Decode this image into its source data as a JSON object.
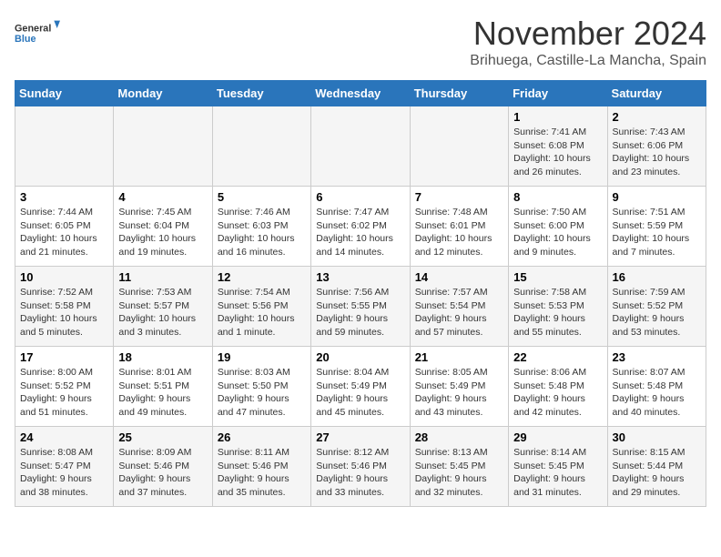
{
  "header": {
    "logo_line1": "General",
    "logo_line2": "Blue",
    "month": "November 2024",
    "location": "Brihuega, Castille-La Mancha, Spain"
  },
  "weekdays": [
    "Sunday",
    "Monday",
    "Tuesday",
    "Wednesday",
    "Thursday",
    "Friday",
    "Saturday"
  ],
  "weeks": [
    [
      {
        "day": "",
        "info": ""
      },
      {
        "day": "",
        "info": ""
      },
      {
        "day": "",
        "info": ""
      },
      {
        "day": "",
        "info": ""
      },
      {
        "day": "",
        "info": ""
      },
      {
        "day": "1",
        "info": "Sunrise: 7:41 AM\nSunset: 6:08 PM\nDaylight: 10 hours and 26 minutes."
      },
      {
        "day": "2",
        "info": "Sunrise: 7:43 AM\nSunset: 6:06 PM\nDaylight: 10 hours and 23 minutes."
      }
    ],
    [
      {
        "day": "3",
        "info": "Sunrise: 7:44 AM\nSunset: 6:05 PM\nDaylight: 10 hours and 21 minutes."
      },
      {
        "day": "4",
        "info": "Sunrise: 7:45 AM\nSunset: 6:04 PM\nDaylight: 10 hours and 19 minutes."
      },
      {
        "day": "5",
        "info": "Sunrise: 7:46 AM\nSunset: 6:03 PM\nDaylight: 10 hours and 16 minutes."
      },
      {
        "day": "6",
        "info": "Sunrise: 7:47 AM\nSunset: 6:02 PM\nDaylight: 10 hours and 14 minutes."
      },
      {
        "day": "7",
        "info": "Sunrise: 7:48 AM\nSunset: 6:01 PM\nDaylight: 10 hours and 12 minutes."
      },
      {
        "day": "8",
        "info": "Sunrise: 7:50 AM\nSunset: 6:00 PM\nDaylight: 10 hours and 9 minutes."
      },
      {
        "day": "9",
        "info": "Sunrise: 7:51 AM\nSunset: 5:59 PM\nDaylight: 10 hours and 7 minutes."
      }
    ],
    [
      {
        "day": "10",
        "info": "Sunrise: 7:52 AM\nSunset: 5:58 PM\nDaylight: 10 hours and 5 minutes."
      },
      {
        "day": "11",
        "info": "Sunrise: 7:53 AM\nSunset: 5:57 PM\nDaylight: 10 hours and 3 minutes."
      },
      {
        "day": "12",
        "info": "Sunrise: 7:54 AM\nSunset: 5:56 PM\nDaylight: 10 hours and 1 minute."
      },
      {
        "day": "13",
        "info": "Sunrise: 7:56 AM\nSunset: 5:55 PM\nDaylight: 9 hours and 59 minutes."
      },
      {
        "day": "14",
        "info": "Sunrise: 7:57 AM\nSunset: 5:54 PM\nDaylight: 9 hours and 57 minutes."
      },
      {
        "day": "15",
        "info": "Sunrise: 7:58 AM\nSunset: 5:53 PM\nDaylight: 9 hours and 55 minutes."
      },
      {
        "day": "16",
        "info": "Sunrise: 7:59 AM\nSunset: 5:52 PM\nDaylight: 9 hours and 53 minutes."
      }
    ],
    [
      {
        "day": "17",
        "info": "Sunrise: 8:00 AM\nSunset: 5:52 PM\nDaylight: 9 hours and 51 minutes."
      },
      {
        "day": "18",
        "info": "Sunrise: 8:01 AM\nSunset: 5:51 PM\nDaylight: 9 hours and 49 minutes."
      },
      {
        "day": "19",
        "info": "Sunrise: 8:03 AM\nSunset: 5:50 PM\nDaylight: 9 hours and 47 minutes."
      },
      {
        "day": "20",
        "info": "Sunrise: 8:04 AM\nSunset: 5:49 PM\nDaylight: 9 hours and 45 minutes."
      },
      {
        "day": "21",
        "info": "Sunrise: 8:05 AM\nSunset: 5:49 PM\nDaylight: 9 hours and 43 minutes."
      },
      {
        "day": "22",
        "info": "Sunrise: 8:06 AM\nSunset: 5:48 PM\nDaylight: 9 hours and 42 minutes."
      },
      {
        "day": "23",
        "info": "Sunrise: 8:07 AM\nSunset: 5:48 PM\nDaylight: 9 hours and 40 minutes."
      }
    ],
    [
      {
        "day": "24",
        "info": "Sunrise: 8:08 AM\nSunset: 5:47 PM\nDaylight: 9 hours and 38 minutes."
      },
      {
        "day": "25",
        "info": "Sunrise: 8:09 AM\nSunset: 5:46 PM\nDaylight: 9 hours and 37 minutes."
      },
      {
        "day": "26",
        "info": "Sunrise: 8:11 AM\nSunset: 5:46 PM\nDaylight: 9 hours and 35 minutes."
      },
      {
        "day": "27",
        "info": "Sunrise: 8:12 AM\nSunset: 5:46 PM\nDaylight: 9 hours and 33 minutes."
      },
      {
        "day": "28",
        "info": "Sunrise: 8:13 AM\nSunset: 5:45 PM\nDaylight: 9 hours and 32 minutes."
      },
      {
        "day": "29",
        "info": "Sunrise: 8:14 AM\nSunset: 5:45 PM\nDaylight: 9 hours and 31 minutes."
      },
      {
        "day": "30",
        "info": "Sunrise: 8:15 AM\nSunset: 5:44 PM\nDaylight: 9 hours and 29 minutes."
      }
    ]
  ]
}
